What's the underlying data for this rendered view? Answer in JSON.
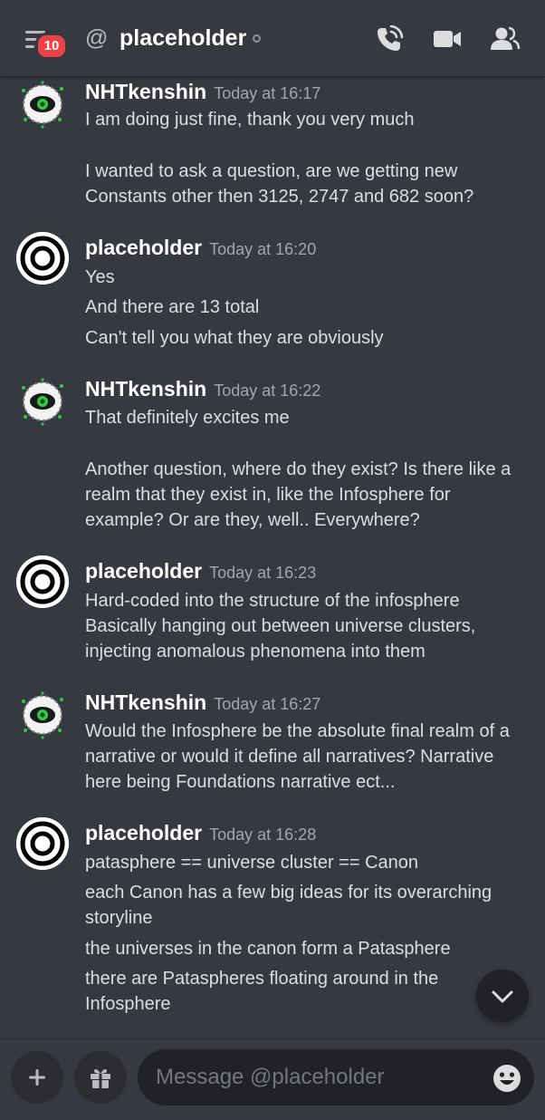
{
  "header": {
    "unread_badge": "10",
    "at_symbol": "@",
    "channel_name": "placeholder",
    "icons": [
      "menu-icon",
      "call-icon",
      "video-icon",
      "members-icon"
    ]
  },
  "messages": [
    {
      "author": "NHTkenshin",
      "timestamp": "Today at 16:17",
      "lines": [
        "I am doing just fine, thank you very much",
        "I wanted to ask a question, are we getting new\nConstants other then 3125, 2747 and 682 soon?"
      ]
    },
    {
      "author": "placeholder",
      "timestamp": "Today at 16:20",
      "lines": [
        "Yes",
        "And there are 13 total",
        "Can't tell you what they are obviously"
      ]
    },
    {
      "author": "NHTkenshin",
      "timestamp": "Today at 16:22",
      "lines": [
        "That definitely excites me",
        "Another question, where do they exist? Is there like a\nrealm that they exist in, like the Infosphere for\nexample? Or are they, well.. Everywhere?"
      ]
    },
    {
      "author": "placeholder",
      "timestamp": "Today at 16:23",
      "lines": [
        "Hard-coded into the structure of the infosphere",
        "Basically hanging out between universe clusters,\ninjecting anomalous phenomena into them"
      ]
    },
    {
      "author": "NHTkenshin",
      "timestamp": "Today at 16:27",
      "lines": [
        "Would the Infosphere be the absolute final realm of a\nnarrative or would it define all narratives? Narrative\nhere being Foundations narrative ect..."
      ]
    },
    {
      "author": "placeholder",
      "timestamp": "Today at 16:28",
      "lines": [
        "patasphere == universe cluster == Canon",
        "each Canon has a few big ideas for its overarching\nstoryline",
        "the universes in the canon form a Patasphere",
        "there are Pataspheres floating around in the\nInfosphere"
      ]
    }
  ],
  "composer": {
    "placeholder": "Message @placeholder",
    "icons": [
      "plus-icon",
      "gift-icon",
      "emoji-icon"
    ]
  },
  "colors": {
    "background": "#36393f",
    "badge": "#ed4245",
    "timestamp": "#a3a6aa",
    "input_background": "#202225"
  }
}
